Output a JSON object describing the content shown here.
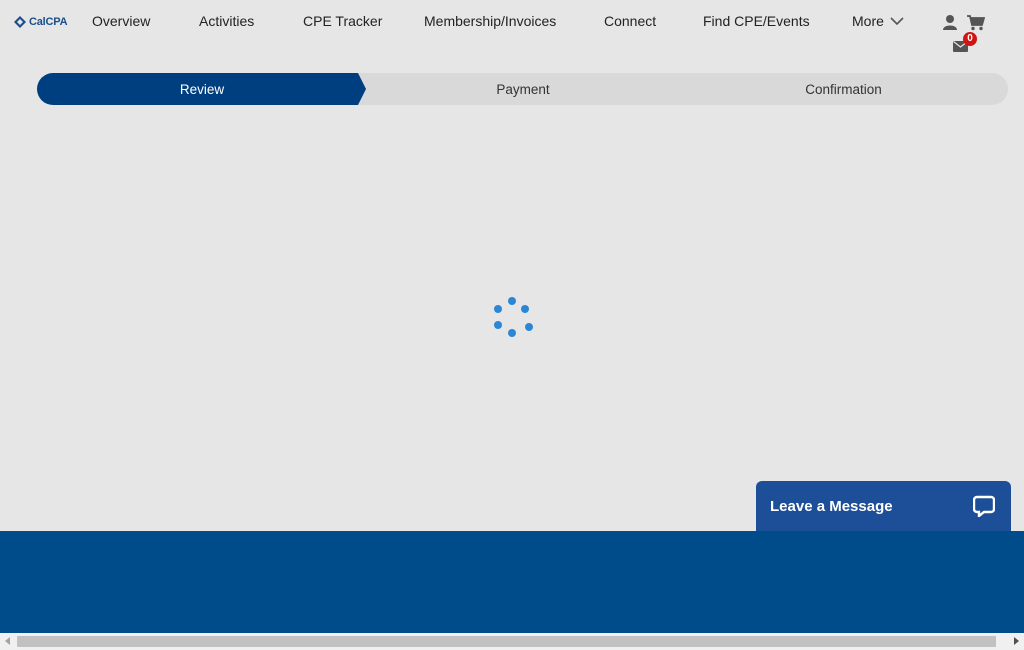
{
  "header": {
    "logo_text": "CalCPA",
    "nav": [
      "Overview",
      "Activities",
      "CPE Tracker",
      "Membership/Invoices",
      "Connect",
      "Find CPE/Events"
    ],
    "more_label": "More",
    "message_count": "0"
  },
  "stepper": {
    "steps": [
      "Review",
      "Payment",
      "Confirmation"
    ],
    "active": "Review"
  },
  "chat": {
    "label": "Leave a Message"
  },
  "colors": {
    "brand_navy": "#003f7f",
    "footer_blue": "#004b8a",
    "chat_blue": "#1d4f99",
    "spinner_blue": "#2b87d6",
    "badge_red": "#d21313"
  }
}
